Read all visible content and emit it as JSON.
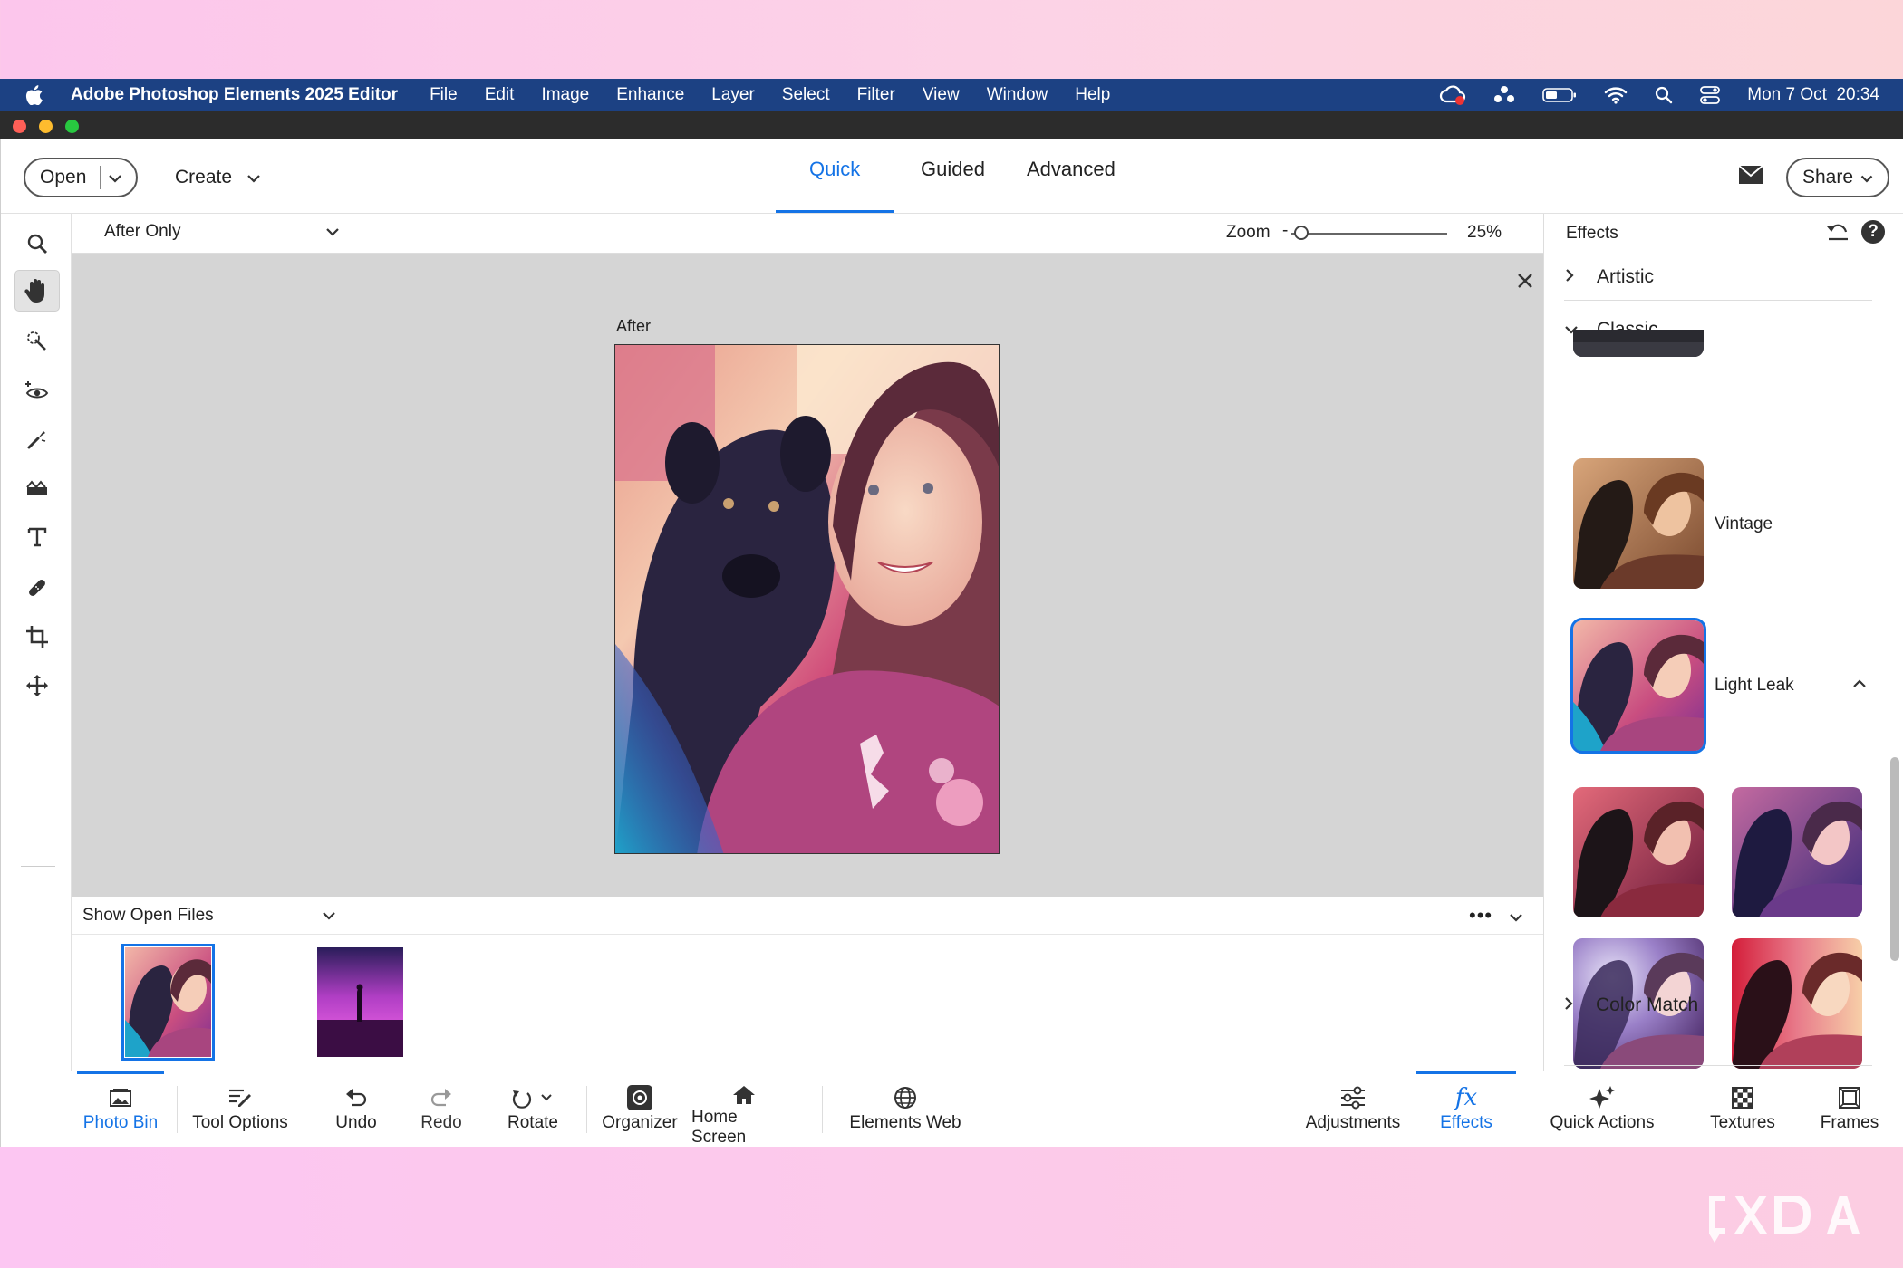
{
  "menubar": {
    "app_name": "Adobe Photoshop Elements 2025 Editor",
    "menus": [
      "File",
      "Edit",
      "Image",
      "Enhance",
      "Layer",
      "Select",
      "Filter",
      "View",
      "Window",
      "Help"
    ],
    "datetime": "Mon 7 Oct  20:34"
  },
  "topbar": {
    "open_label": "Open",
    "create_label": "Create",
    "modes": [
      "Quick",
      "Guided",
      "Advanced"
    ],
    "active_mode": "Quick",
    "share_label": "Share"
  },
  "canvas": {
    "view_option": "After Only",
    "zoom_label": "Zoom",
    "zoom_value": "25%",
    "zoom_level_fraction": 0.02,
    "after_label": "After"
  },
  "photo_bin": {
    "show_label": "Show Open Files",
    "more_label": "•••"
  },
  "effects_panel": {
    "title": "Effects",
    "help_label": "?",
    "categories": {
      "artistic": "Artistic",
      "classic": "Classic",
      "color_match": "Color Match"
    },
    "effects": {
      "vintage": "Vintage",
      "light_leak": "Light Leak"
    }
  },
  "dock": {
    "photo_bin": "Photo Bin",
    "tool_options": "Tool Options",
    "undo": "Undo",
    "redo": "Redo",
    "rotate": "Rotate",
    "organizer": "Organizer",
    "home_screen": "Home Screen",
    "elements_web": "Elements Web",
    "adjustments": "Adjustments",
    "effects": "Effects",
    "quick_actions": "Quick Actions",
    "textures": "Textures",
    "frames": "Frames"
  },
  "colors": {
    "accent": "#1473e6",
    "menubar": "#1c4183"
  }
}
